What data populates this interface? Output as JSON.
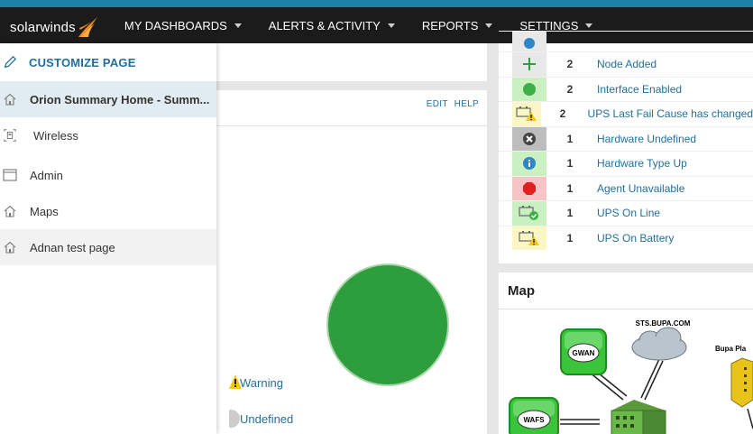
{
  "brand": {
    "name": "solarwinds"
  },
  "nav": [
    {
      "label": "MY DASHBOARDS"
    },
    {
      "label": "ALERTS & ACTIVITY"
    },
    {
      "label": "REPORTS"
    },
    {
      "label": "SETTINGS"
    }
  ],
  "menu": {
    "customize_label": "CUSTOMIZE PAGE",
    "items": [
      {
        "label": "Orion Summary Home - Summ...",
        "icon": "home-icon",
        "state": "active"
      },
      {
        "label": "Wireless",
        "icon": "wireless-icon"
      },
      {
        "label": "Admin",
        "icon": "window-icon"
      },
      {
        "label": "Maps",
        "icon": "home-icon"
      },
      {
        "label": "Adnan test page",
        "icon": "home-icon",
        "state": "hover"
      }
    ]
  },
  "left_panel": {
    "edit_label": "EDIT",
    "help_label": "HELP",
    "legend": [
      {
        "label": "Warning",
        "icon": "warning-icon"
      },
      {
        "label": "Undefined",
        "icon": "undefined-icon"
      }
    ]
  },
  "events": [
    {
      "count": "2",
      "text": "Node Added",
      "icon": "plus-icon",
      "bg": "#e8e8e8"
    },
    {
      "count": "2",
      "text": "Interface Enabled",
      "icon": "green-dot-icon",
      "bg": "#c9f0c1"
    },
    {
      "count": "2",
      "text": "UPS Last Fail Cause has changed",
      "icon": "battery-warning-icon",
      "bg": "#fbf7c4"
    },
    {
      "count": "1",
      "text": "Hardware Undefined",
      "icon": "x-circle-icon",
      "bg": "#bdbdbd"
    },
    {
      "count": "1",
      "text": "Hardware Type Up",
      "icon": "info-icon",
      "bg": "#c9f0c1"
    },
    {
      "count": "1",
      "text": "Agent Unavailable",
      "icon": "red-stop-icon",
      "bg": "#f6c4c4"
    },
    {
      "count": "1",
      "text": "UPS On Line",
      "icon": "battery-ok-icon",
      "bg": "#c9f0c1"
    },
    {
      "count": "1",
      "text": "UPS On Battery",
      "icon": "battery-warning-icon",
      "bg": "#fbf7c4"
    }
  ],
  "map": {
    "title": "Map",
    "labels": {
      "gwan": "GWAN",
      "wafs": "WAFS",
      "sts": "STS.BUPA.COM",
      "bupa": "Bupa Pla"
    }
  },
  "colors": {
    "nav_bg": "#1b1b1b",
    "accent": "#1d7fa6",
    "link": "#1f6f9c"
  }
}
